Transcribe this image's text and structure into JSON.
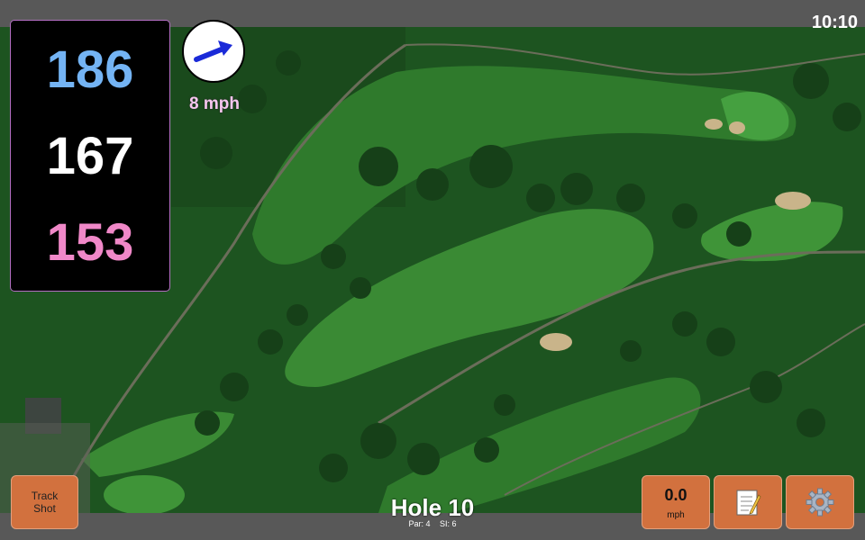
{
  "status": {
    "time": "10:10"
  },
  "yardages": {
    "back": "186",
    "middle": "167",
    "front": "153"
  },
  "wind": {
    "speed_label": "8 mph",
    "direction_icon": "arrow-icon"
  },
  "hole": {
    "title": "Hole 10",
    "par_label": "Par: 4",
    "si_label": "SI: 6"
  },
  "buttons": {
    "track_shot_line1": "Track",
    "track_shot_line2": "Shot",
    "speed_value": "0.0",
    "speed_unit": "mph",
    "notes_icon": "notepad-icon",
    "settings_icon": "gear-icon"
  },
  "colors": {
    "back": "#74b4f4",
    "middle": "#ffffff",
    "front": "#f088c8",
    "button": "#d2713e"
  }
}
